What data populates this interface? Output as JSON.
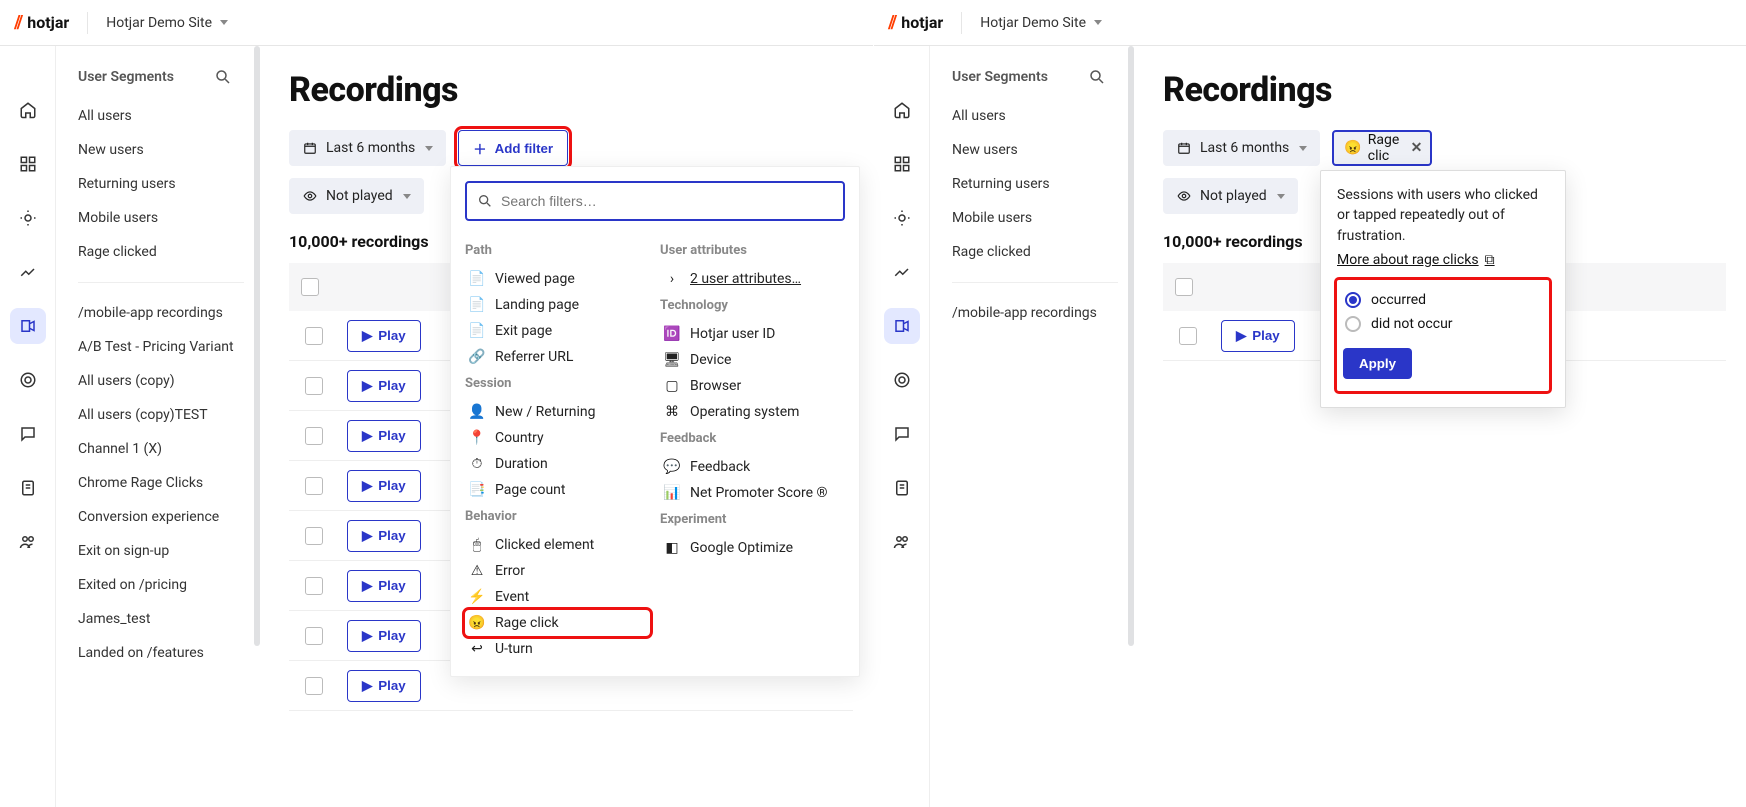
{
  "brand": "hotjar",
  "site_name": "Hotjar Demo Site",
  "page_title": "Recordings",
  "segments": {
    "title": "User Segments",
    "primary": [
      "All users",
      "New users",
      "Returning users",
      "Mobile users",
      "Rage clicked"
    ],
    "secondary": [
      "/mobile-app recordings",
      "A/B Test - Pricing Variant",
      "All users (copy)",
      "All users (copy)TEST",
      "Channel 1 (X)",
      "Chrome Rage Clicks",
      "Conversion experience",
      "Exit on sign-up",
      "Exited on /pricing",
      "James_test",
      "Landed on /features"
    ]
  },
  "filters": {
    "date_label": "Last 6 months",
    "add_filter": "Add filter",
    "not_played": "Not played",
    "rage_chip": "Rage clic"
  },
  "count_label": "10,000+ recordings",
  "play_label": "Play",
  "search_placeholder": "Search filters…",
  "filter_groups": {
    "path": {
      "title": "Path",
      "items": [
        "Viewed page",
        "Landing page",
        "Exit page",
        "Referrer URL"
      ]
    },
    "session": {
      "title": "Session",
      "items": [
        "New / Returning",
        "Country",
        "Duration",
        "Page count"
      ]
    },
    "behavior": {
      "title": "Behavior",
      "items": [
        "Clicked element",
        "Error",
        "Event",
        "Rage click",
        "U-turn"
      ]
    },
    "user_attr": {
      "title": "User attributes",
      "link": "2 user attributes…"
    },
    "tech": {
      "title": "Technology",
      "items": [
        "Hotjar user ID",
        "Device",
        "Browser",
        "Operating system"
      ]
    },
    "feedback": {
      "title": "Feedback",
      "items": [
        "Feedback",
        "Net Promoter Score ®"
      ]
    },
    "experiment": {
      "title": "Experiment",
      "items": [
        "Google Optimize"
      ]
    }
  },
  "rage_popup": {
    "desc": "Sessions with users who clicked or tapped repeatedly out of frustration.",
    "more": "More about rage clicks",
    "opt_occurred": "occurred",
    "opt_not": "did not occur",
    "apply": "Apply"
  },
  "colors": {
    "accent": "#2a36c8",
    "highlight": "#e11"
  }
}
